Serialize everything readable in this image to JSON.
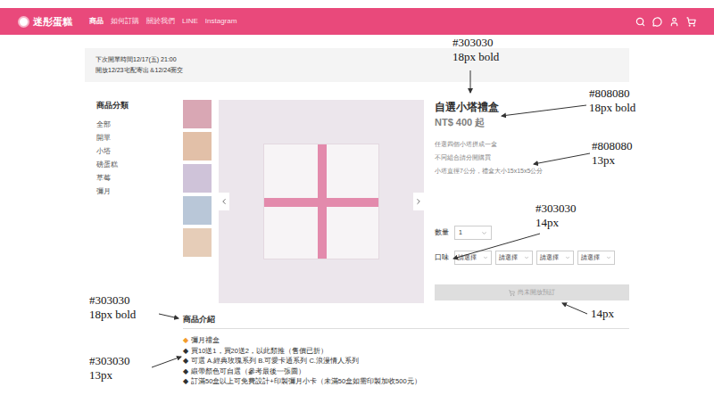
{
  "header": {
    "logo": "迷彤蛋糕",
    "nav": [
      {
        "label": "商品",
        "selected": true
      },
      {
        "label": "如何訂購",
        "selected": false
      },
      {
        "label": "關於我們",
        "selected": false
      },
      {
        "label": "LINE",
        "selected": false
      },
      {
        "label": "Instagram",
        "selected": false
      }
    ]
  },
  "notice": [
    "下次開單時間12/17(五) 21:00",
    "開放12/23宅配寄出＆12/24面交"
  ],
  "sidebar": {
    "title": "商品分類",
    "items": [
      "全部",
      "開單",
      "小塔",
      "磅蛋糕",
      "草莓",
      "彌月"
    ]
  },
  "product": {
    "title": "自選小塔禮盒",
    "price": "NT$ 400 起",
    "description": [
      "任選四個小塔拼成一盒",
      "不同組合請分開購買",
      "小塔直徑7公分，禮盒大小15x15x5公分"
    ],
    "quantity": {
      "label": "數量",
      "value": "1"
    },
    "flavor": {
      "label": "口味",
      "selects": [
        "請選擇",
        "請選擇",
        "請選擇",
        "請選擇"
      ]
    },
    "button": {
      "label": "尚未開放預訂",
      "disabled": true
    }
  },
  "intro": {
    "title": "商品介紹",
    "items": [
      {
        "kind": "heading",
        "bullet": "◆",
        "text": "彌月禮盒"
      },
      {
        "kind": "item",
        "bullet": "◆",
        "text": "買10送1，買20送2，以此類推（售價已折）"
      },
      {
        "kind": "item",
        "bullet": "◆",
        "text": "可選 A.經典玫瑰系列 B.可愛卡通系列 C.浪漫情人系列"
      },
      {
        "kind": "item",
        "bullet": "◆",
        "text": "緞帶顏色可自選（參考最後一張圖）"
      },
      {
        "kind": "item",
        "bullet": "◆",
        "text": "訂滿50盒以上可免費設計+印製彌月小卡（未滿50盒如需印製加收500元）"
      }
    ]
  },
  "annotations": [
    {
      "lines": [
        "#303030",
        "18px bold"
      ]
    },
    {
      "lines": [
        "#808080",
        "18px bold"
      ]
    },
    {
      "lines": [
        "#808080",
        "13px"
      ]
    },
    {
      "lines": [
        "#303030",
        "14px"
      ]
    },
    {
      "lines": [
        "14px"
      ]
    },
    {
      "lines": [
        "#303030",
        "18px bold"
      ]
    },
    {
      "lines": [
        "#303030",
        "13px"
      ]
    }
  ]
}
